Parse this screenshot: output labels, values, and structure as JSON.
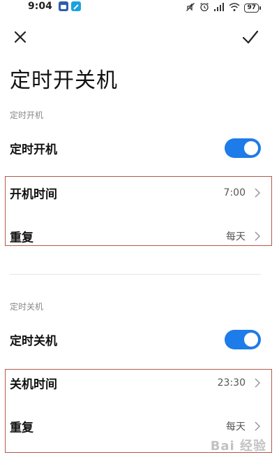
{
  "status_bar": {
    "time": "9:04",
    "battery_level": "97",
    "icons": [
      "app-icon-blue",
      "app-icon-teal",
      "mute-icon",
      "alarm-icon",
      "signal-icon",
      "wifi-icon",
      "battery-icon"
    ]
  },
  "toolbar": {
    "close_icon": "close-icon",
    "confirm_icon": "check-icon"
  },
  "page": {
    "title": "定时开关机"
  },
  "power_on": {
    "section_header": "定时开机",
    "toggle_label": "定时开机",
    "toggle_on": true,
    "time_label": "开机时间",
    "time_value": "7:00",
    "repeat_label": "重复",
    "repeat_value": "每天"
  },
  "power_off": {
    "section_header": "定时关机",
    "toggle_label": "定时关机",
    "toggle_on": true,
    "time_label": "关机时间",
    "time_value": "23:30",
    "repeat_label": "重复",
    "repeat_value": "每天"
  },
  "colors": {
    "accent": "#1e7bea",
    "highlight_border": "#b35a4a"
  },
  "watermark": "Bai 经验"
}
